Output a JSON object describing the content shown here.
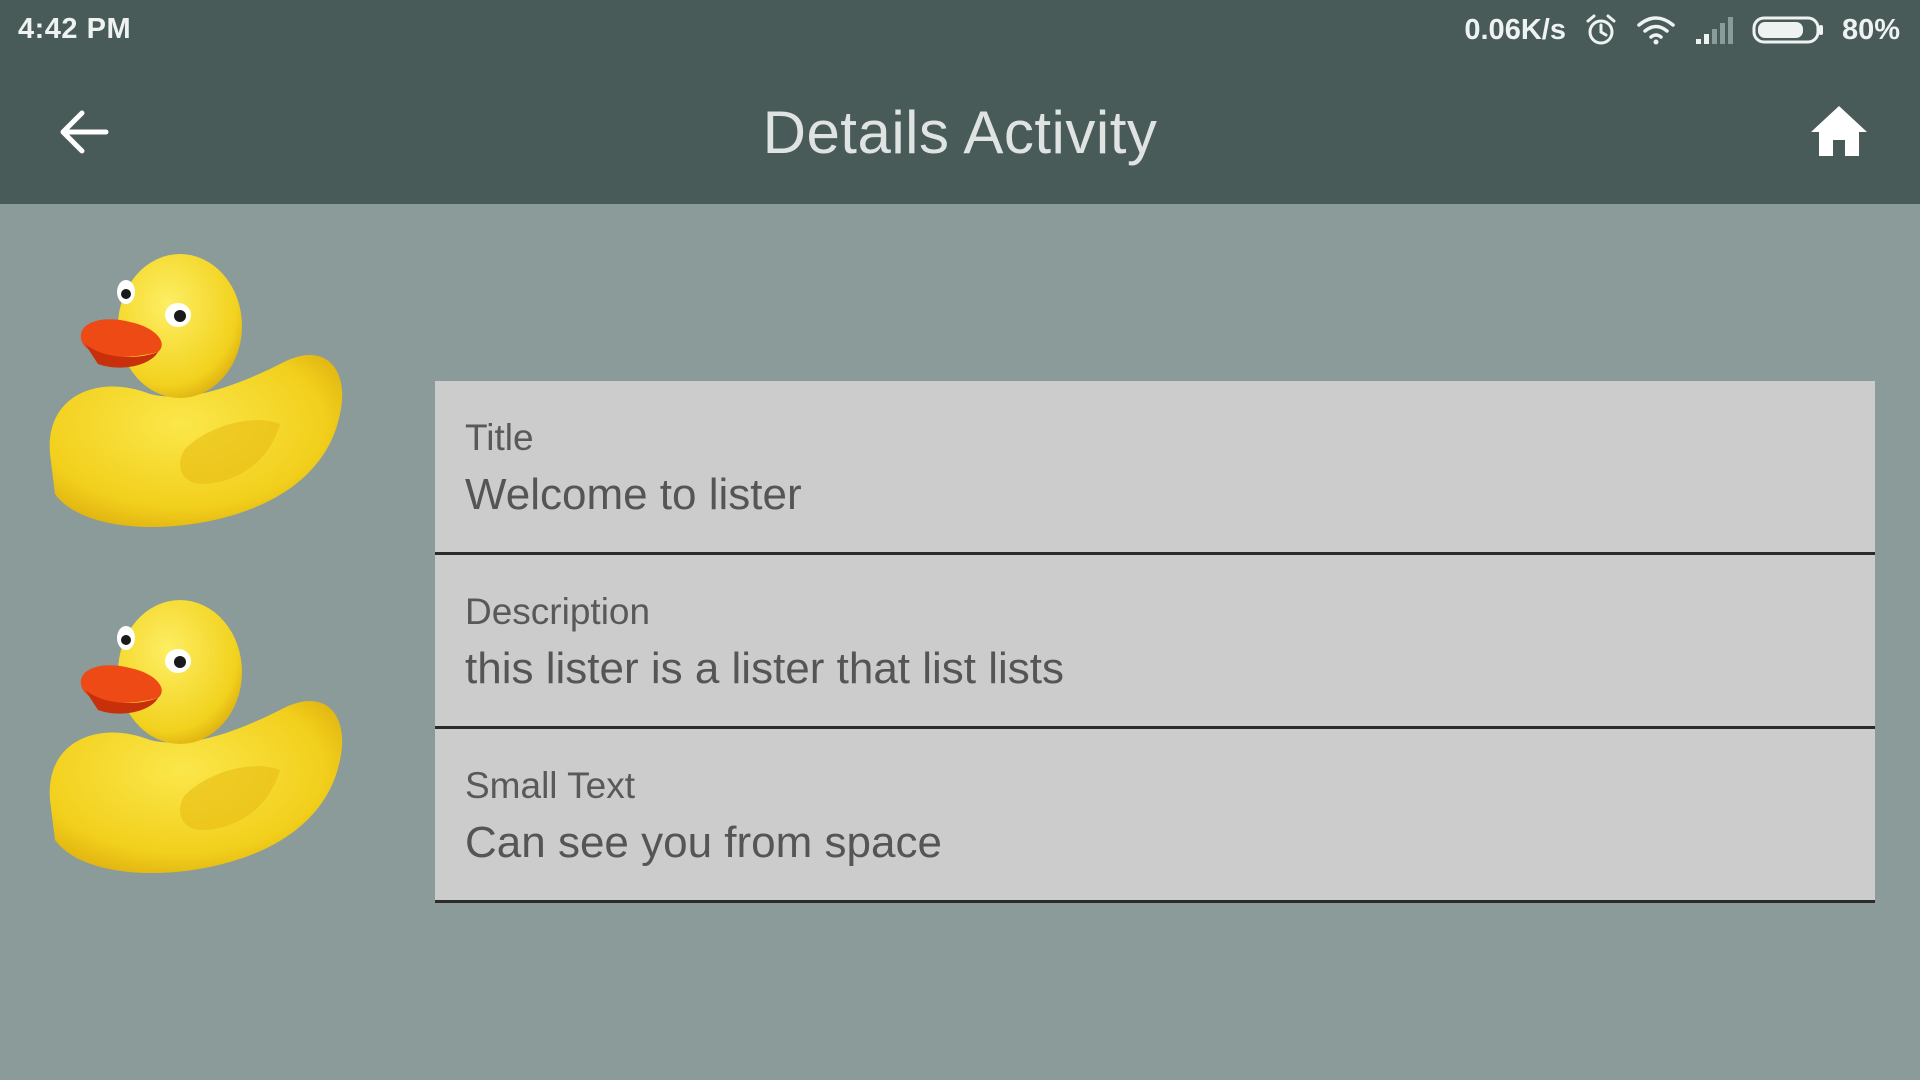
{
  "status_bar": {
    "time": "4:42 PM",
    "network_speed": "0.06K/s",
    "battery_percent": "80%",
    "battery_level": 0.8,
    "icons": [
      "alarm-icon",
      "wifi-icon",
      "signal-icon",
      "battery-icon"
    ]
  },
  "app_bar": {
    "title": "Details Activity",
    "back_icon": "arrow-left-icon",
    "home_icon": "home-icon"
  },
  "images": [
    {
      "name": "rubber-duck"
    },
    {
      "name": "rubber-duck"
    }
  ],
  "details": [
    {
      "label": "Title",
      "value": "Welcome to lister"
    },
    {
      "label": "Description",
      "value": "this lister is a lister that list lists"
    },
    {
      "label": "Small Text",
      "value": "Can see you from space"
    }
  ],
  "colors": {
    "bar_background": "#485b59",
    "page_background": "#8a9b99",
    "card_background": "#cccccc",
    "divider": "#2b2b2b"
  }
}
